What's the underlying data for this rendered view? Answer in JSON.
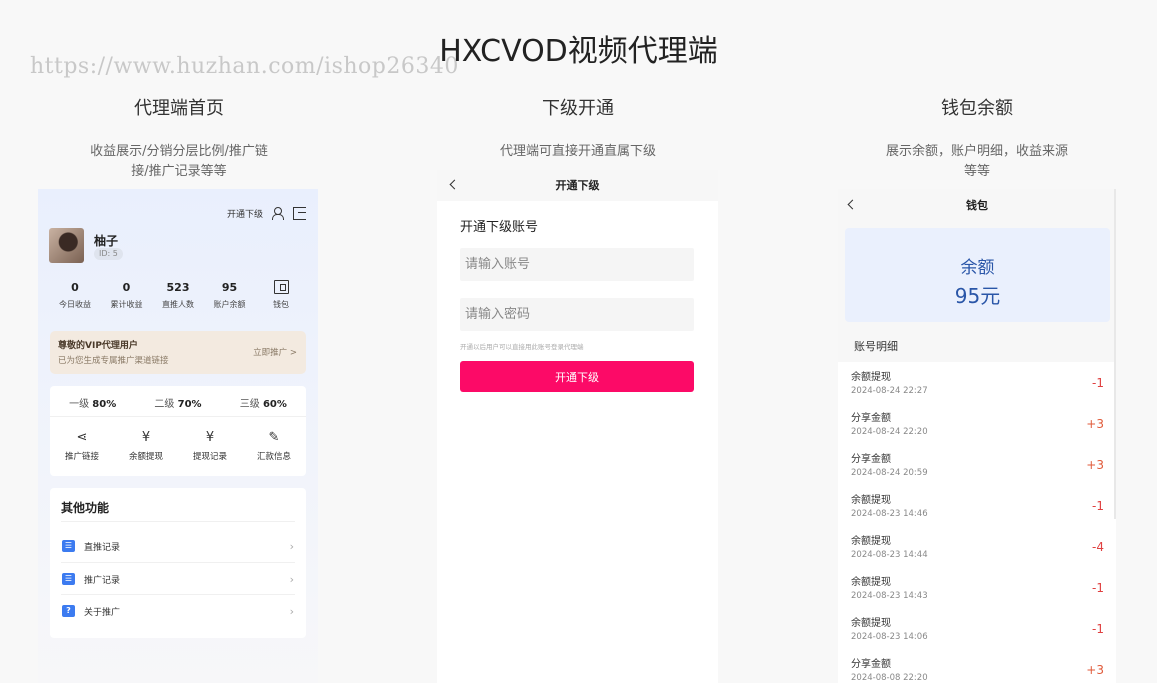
{
  "watermark": "https://www.huzhan.com/ishop26340",
  "title": "HXCVOD视频代理端",
  "columns": [
    {
      "heading": "代理端首页",
      "desc1": "收益展示/分销分层比例/推广链",
      "desc2": "接/推广记录等等"
    },
    {
      "heading": "下级开通",
      "desc1": "代理端可直接开通直属下级",
      "desc2": ""
    },
    {
      "heading": "钱包余额",
      "desc1": "展示余额，账户明细，收益来源",
      "desc2": "等等"
    }
  ],
  "panel1": {
    "open_sub": "开通下级",
    "icons": [
      "user-add-icon",
      "logout-icon"
    ],
    "user": {
      "name": "柚子",
      "id": "ID: 5"
    },
    "stats": [
      {
        "value": "0",
        "label": "今日收益"
      },
      {
        "value": "0",
        "label": "累计收益"
      },
      {
        "value": "523",
        "label": "直推人数"
      },
      {
        "value": "95",
        "label": "账户余额"
      },
      {
        "value": "",
        "label": "钱包"
      }
    ],
    "vip": {
      "title": "尊敬的VIP代理用户",
      "subtitle": "已为您生成专属推广渠道链接",
      "action": "立即推广 >"
    },
    "levels": [
      {
        "name": "一级",
        "pct": "80%"
      },
      {
        "name": "二级",
        "pct": "70%"
      },
      {
        "name": "三级",
        "pct": "60%"
      }
    ],
    "actions": [
      {
        "label": "推广链接",
        "icon": "share-icon",
        "glyph": "⋖"
      },
      {
        "label": "余额提现",
        "icon": "wallet-yen-icon",
        "glyph": "¥"
      },
      {
        "label": "提现记录",
        "icon": "yen-cycle-icon",
        "glyph": "¥"
      },
      {
        "label": "汇款信息",
        "icon": "edit-icon",
        "glyph": "✎"
      }
    ],
    "other_title": "其他功能",
    "menu": [
      {
        "label": "直推记录",
        "badge": "☰"
      },
      {
        "label": "推广记录",
        "badge": "☰"
      },
      {
        "label": "关于推广",
        "badge": "?"
      }
    ],
    "chevron": "›"
  },
  "panel2": {
    "nav_title": "开通下级",
    "account_label": "开通下级账号",
    "account_placeholder": "请输入账号",
    "password_placeholder": "请输入密码",
    "hint": "开通以后用户可以直接用此账号登录代理端",
    "button": "开通下级"
  },
  "panel3": {
    "nav_title": "钱包",
    "balance_label": "余额",
    "balance_value": "95元",
    "detail_label": "账号明细",
    "records": [
      {
        "title": "余额提现",
        "date": "2024-08-24 22:27",
        "amount": "-1"
      },
      {
        "title": "分享金额",
        "date": "2024-08-24 22:20",
        "amount": "+3"
      },
      {
        "title": "分享金额",
        "date": "2024-08-24 20:59",
        "amount": "+3"
      },
      {
        "title": "余额提现",
        "date": "2024-08-23 14:46",
        "amount": "-1"
      },
      {
        "title": "余额提现",
        "date": "2024-08-23 14:44",
        "amount": "-4"
      },
      {
        "title": "余额提现",
        "date": "2024-08-23 14:43",
        "amount": "-1"
      },
      {
        "title": "余额提现",
        "date": "2024-08-23 14:06",
        "amount": "-1"
      },
      {
        "title": "分享金额",
        "date": "2024-08-08 22:20",
        "amount": "+3"
      }
    ]
  }
}
